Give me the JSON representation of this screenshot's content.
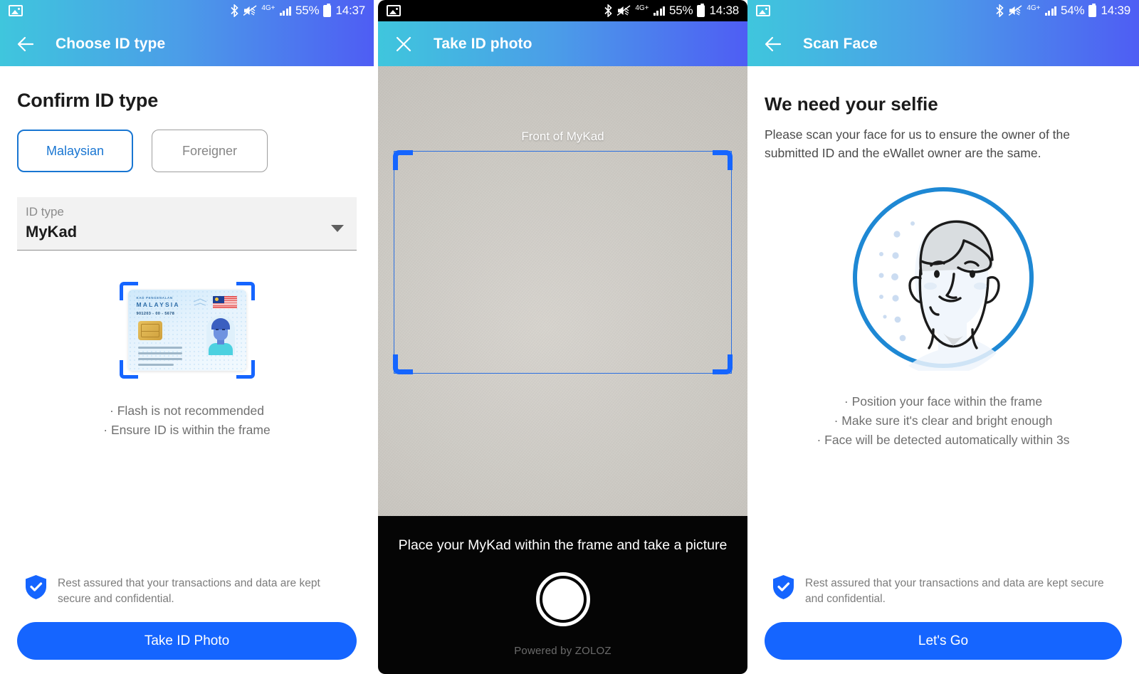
{
  "screens": [
    {
      "status": {
        "photo_icon": "photo-icon",
        "bluetooth_icon": "bluetooth-icon",
        "mute_icon": "volume-mute-icon",
        "network": "4G+",
        "signal_icon": "signal-bars-icon",
        "battery_percent": "55%",
        "battery_icon": "battery-icon",
        "time": "14:37"
      },
      "appbar": {
        "back_icon": "arrow-back-icon",
        "title": "Choose ID type"
      },
      "heading": "Confirm ID type",
      "segments": [
        {
          "label": "Malaysian",
          "selected": true
        },
        {
          "label": "Foreigner",
          "selected": false
        }
      ],
      "id_field": {
        "label": "ID type",
        "value": "MyKad",
        "caret_icon": "chevron-down-icon"
      },
      "card": {
        "title_small": "KAD PENGENALAN",
        "title": "MALAYSIA",
        "number": "901203 - 00 - 5678",
        "flag_icon": "malaysia-flag-icon",
        "chip_icon": "smartcard-chip-icon",
        "portrait_icon": "id-portrait-icon"
      },
      "hints": [
        "· Flash is not recommended",
        "· Ensure ID is within the frame"
      ],
      "assurance": {
        "shield_icon": "shield-check-icon",
        "text": "Rest assured that your transactions and data are kept secure and confidential."
      },
      "cta": "Take ID Photo"
    },
    {
      "status": {
        "photo_icon": "photo-icon",
        "bluetooth_icon": "bluetooth-icon",
        "mute_icon": "volume-mute-icon",
        "network": "4G+",
        "signal_icon": "signal-bars-icon",
        "battery_percent": "55%",
        "battery_icon": "battery-icon",
        "time": "14:38"
      },
      "appbar": {
        "close_icon": "close-icon",
        "title": "Take ID photo"
      },
      "camera": {
        "frame_label": "Front of MyKad",
        "frame_icon": "document-scan-frame-icon",
        "instruction": "Place your MyKad within the frame and take a picture",
        "shutter_icon": "camera-shutter-button",
        "powered_by": "Powered by ZOLOZ"
      }
    },
    {
      "status": {
        "photo_icon": "photo-icon",
        "bluetooth_icon": "bluetooth-icon",
        "mute_icon": "volume-mute-icon",
        "network": "4G+",
        "signal_icon": "signal-bars-icon",
        "battery_percent": "54%",
        "battery_icon": "battery-icon",
        "time": "14:39"
      },
      "appbar": {
        "back_icon": "arrow-back-icon",
        "title": "Scan Face"
      },
      "heading": "We need your selfie",
      "paragraph": "Please scan your face for us to ensure the owner of the submitted ID and the eWallet owner are the same.",
      "illustration_icon": "selfie-face-circle-icon",
      "hints": [
        "· Position your face within the frame",
        "· Make sure it's clear and bright enough",
        "· Face will be detected automatically within 3s"
      ],
      "assurance": {
        "shield_icon": "shield-check-icon",
        "text": "Rest assured that your transactions and data are kept secure and confidential."
      },
      "cta": "Let's Go"
    }
  ],
  "colors": {
    "accent_blue": "#1565ff",
    "header_gradient_start": "#3fc6dd",
    "header_gradient_end": "#4e5df4",
    "muted_text": "#7c7c7c",
    "selected_border": "#1976d2"
  }
}
